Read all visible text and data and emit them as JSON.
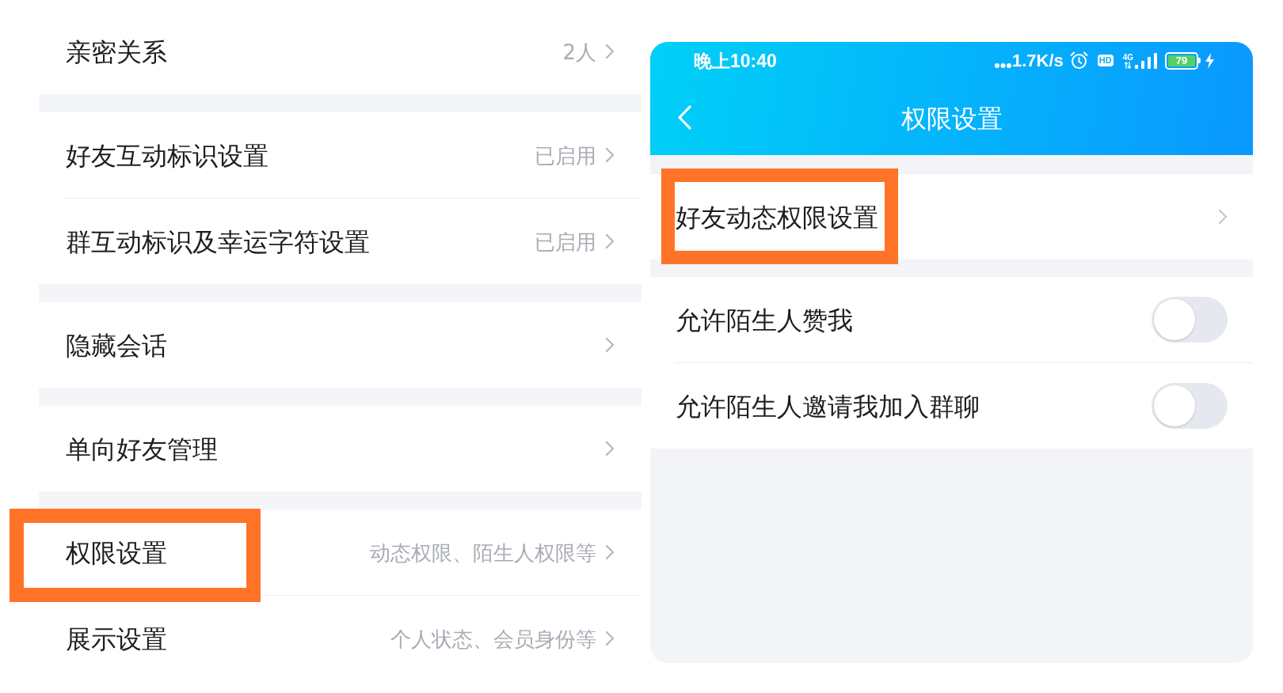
{
  "settings_list": {
    "groups": [
      {
        "items": [
          {
            "label": "亲密关系",
            "value": "2人",
            "highlighted": false
          }
        ]
      },
      {
        "items": [
          {
            "label": "好友互动标识设置",
            "value": "已启用",
            "highlighted": false
          },
          {
            "label": "群互动标识及幸运字符设置",
            "value": "已启用",
            "highlighted": false
          }
        ]
      },
      {
        "items": [
          {
            "label": "隐藏会话",
            "highlighted": false
          }
        ]
      },
      {
        "items": [
          {
            "label": "单向好友管理",
            "highlighted": false
          }
        ]
      },
      {
        "items": [
          {
            "label": "权限设置",
            "value": "动态权限、陌生人权限等",
            "highlighted": true
          },
          {
            "label": "展示设置",
            "value": "个人状态、会员身份等",
            "highlighted": false
          }
        ]
      }
    ]
  },
  "phone_screen": {
    "status_bar": {
      "time": "晚上10:40",
      "net_speed": "1.7K/s",
      "hd": "HD",
      "network": "4G",
      "battery": "79"
    },
    "nav_bar": {
      "title": "权限设置"
    },
    "groups": [
      {
        "items": [
          {
            "kind": "link",
            "label": "好友动态权限设置",
            "highlighted": true
          }
        ]
      },
      {
        "items": [
          {
            "kind": "toggle",
            "label": "允许陌生人赞我",
            "on": false,
            "highlighted": false
          },
          {
            "kind": "toggle",
            "label": "允许陌生人邀请我加入群聊",
            "on": false,
            "highlighted": false
          }
        ]
      }
    ]
  }
}
